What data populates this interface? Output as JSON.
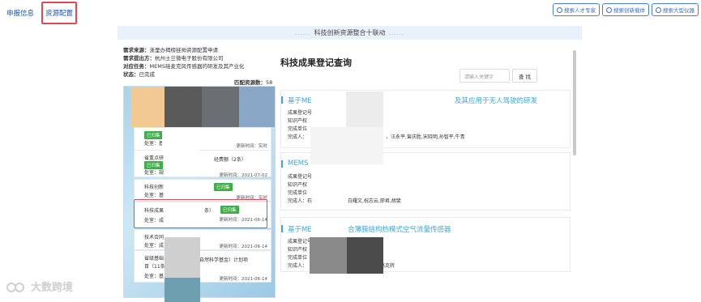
{
  "top_tabs": [
    "申报信息",
    "资源配置"
  ],
  "search_buttons": [
    "搜索人才专家",
    "搜索创新载体",
    "搜索大型仪器"
  ],
  "banner": {
    "title": "科技创新资源整合十联动",
    "dots": "......"
  },
  "info": {
    "source_label": "需求来源：",
    "source_value": "浙里办揭榜挂帅资源配置申请",
    "proposer_label": "需求提出方：",
    "proposer_value": "杭州士兰微电子股份有限公司",
    "task_label": "对应任务：",
    "task_value": "MEMS硅麦克风传感器的研发及其产业化",
    "status_label": "状态：",
    "status_value": "已完成",
    "match_label": "匹配资源数：",
    "match_value": "58"
  },
  "cards": [
    {
      "tag": "已归集",
      "dept": "处室：基",
      "time": "更新时间：实时"
    },
    {
      "title": "省重点研",
      "title2": "经费额（2条）",
      "tag": "已归集",
      "dept": "处室：规",
      "time": "更新时间：2021-07-02"
    },
    {
      "title": "科技创新",
      "tag": "已归集",
      "dept": "处室：基",
      "time": "更新时间：实时"
    },
    {
      "title": "科技成果",
      "title_suffix": "条）",
      "tag": "已归集",
      "dept": "处室：成",
      "time": "更新时间：2021-06-14"
    },
    {
      "title": "技术合同",
      "dept": "处室：成",
      "time": "更新时间：2021-06-14"
    },
    {
      "title": "省级基础",
      "title_suffix": "自然科学基金）计划项",
      "title_line2": "目（11条",
      "dept": "处室：基",
      "time": "更新时间：2021-06-14"
    }
  ],
  "right": {
    "title": "科技成果登记查询",
    "search_placeholder": "请输入关键字",
    "search_button": "查 找"
  },
  "results": [
    {
      "title_start": "基于ME",
      "title_end": "及其应用于无人驾驶的研发",
      "lines": [
        "成果登记号",
        "知识产权",
        "完成单位",
        "完成人："
      ],
      "people": "，汪永平,曾庆胜,宋晓明,孙智平,牛青"
    },
    {
      "title_start": "MEMS",
      "lines": [
        "成果登记号",
        "知识产权",
        "完成单位",
        "完成人：石"
      ],
      "people": "白耀文,祝志云,廖君,胡斐"
    },
    {
      "title_start": "基于ME",
      "title_end": "合薄膜结构热模式空气流量传感器",
      "lines": [
        "成果登记号",
        "知识产权",
        "完成单位",
        "完成人："
      ],
      "people": "高克转"
    }
  ],
  "watermark": "大数跨境"
}
